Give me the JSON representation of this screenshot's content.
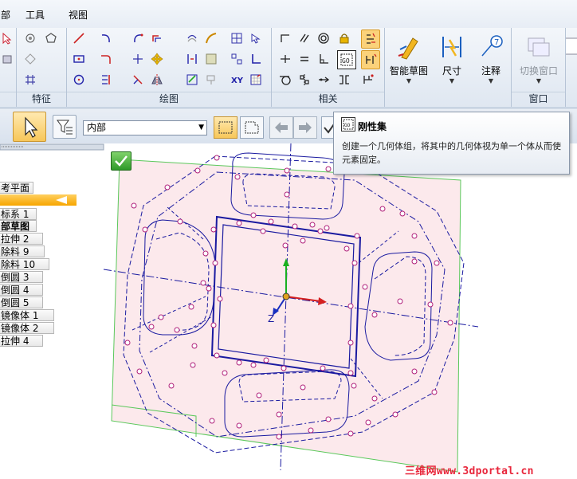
{
  "menu": {
    "item1": "工具",
    "item2": "视图"
  },
  "ribbon": {
    "groups": {
      "feature": "特征",
      "draw": "绘图",
      "relate": "相关",
      "window": "窗口"
    },
    "buttons": {
      "smart_sketch": "智能草图",
      "dimension": "尺寸",
      "annotation": "注释",
      "switch_window": "切换窗口"
    }
  },
  "toolbar": {
    "select_value": "内部"
  },
  "tooltip": {
    "title": "刚性集",
    "description": "创建一个几何体组，将其中的几何体视为单一个体从而使元素固定。"
  },
  "tree": {
    "items": [
      "考平面",
      "标系 1",
      "部草图",
      "拉伸 2",
      "除料 9",
      "除料 10",
      "倒圆 3",
      "倒圆 4",
      "倒圆 5",
      "镜像体 1",
      "镜像体 2",
      "拉伸 4"
    ]
  },
  "watermark": {
    "text": "三维网www.3dportal.cn"
  },
  "colors": {
    "sketch_plane": "#fce9ec",
    "geometry": "#1a1aa0",
    "relation_marker": "#b0207a",
    "accent": "#f7a600"
  }
}
